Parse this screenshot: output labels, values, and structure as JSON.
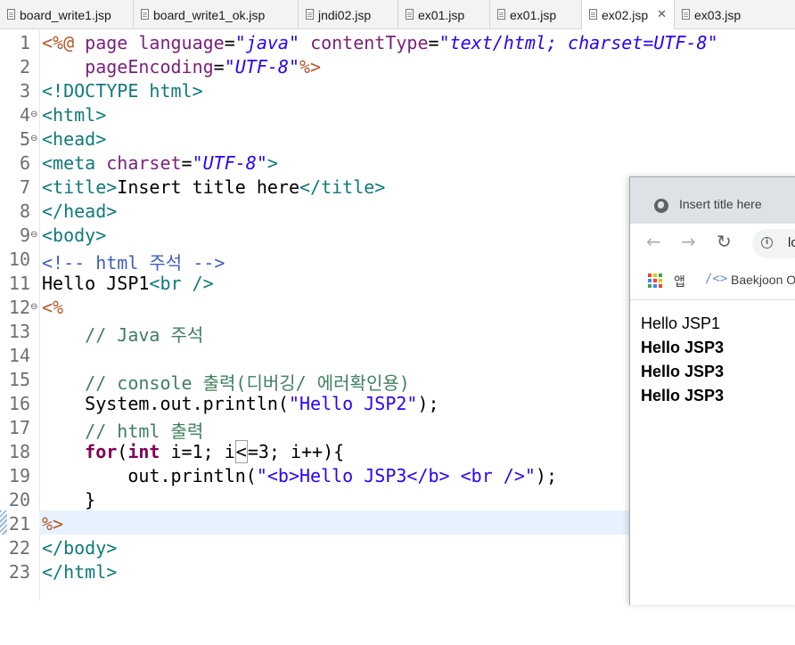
{
  "tabs": [
    {
      "label": "board_write1.jsp"
    },
    {
      "label": "board_write1_ok.jsp"
    },
    {
      "label": "jndi02.jsp"
    },
    {
      "label": "ex01.jsp"
    },
    {
      "label": "ex01.jsp"
    },
    {
      "label": "ex02.jsp",
      "active": true,
      "close": "✕"
    },
    {
      "label": "ex03.jsp"
    }
  ],
  "editor": {
    "current_line": 21,
    "lines": [
      {
        "n": "1",
        "fold": ""
      },
      {
        "n": "2",
        "fold": ""
      },
      {
        "n": "3",
        "fold": ""
      },
      {
        "n": "4",
        "fold": "⊖"
      },
      {
        "n": "5",
        "fold": "⊖"
      },
      {
        "n": "6",
        "fold": ""
      },
      {
        "n": "7",
        "fold": ""
      },
      {
        "n": "8",
        "fold": ""
      },
      {
        "n": "9",
        "fold": "⊖"
      },
      {
        "n": "10",
        "fold": ""
      },
      {
        "n": "11",
        "fold": ""
      },
      {
        "n": "12",
        "fold": "⊖"
      },
      {
        "n": "13",
        "fold": ""
      },
      {
        "n": "14",
        "fold": ""
      },
      {
        "n": "15",
        "fold": ""
      },
      {
        "n": "16",
        "fold": ""
      },
      {
        "n": "17",
        "fold": ""
      },
      {
        "n": "18",
        "fold": ""
      },
      {
        "n": "19",
        "fold": ""
      },
      {
        "n": "20",
        "fold": ""
      },
      {
        "n": "21",
        "fold": ""
      },
      {
        "n": "22",
        "fold": ""
      },
      {
        "n": "23",
        "fold": ""
      }
    ],
    "tokens": {
      "l1": [
        "<%@ ",
        "page ",
        "language",
        "=",
        "\"java\"",
        " ",
        "contentType",
        "=",
        "\"text/html; charset=UTF-8\""
      ],
      "l2": [
        "    ",
        "pageEncoding",
        "=",
        "\"UTF-8\"",
        "%>"
      ],
      "l3": [
        "<!DOCTYPE html>"
      ],
      "l4": [
        "<html>"
      ],
      "l5": [
        "<head>"
      ],
      "l6": [
        "<meta ",
        "charset",
        "=",
        "\"UTF-8\"",
        ">"
      ],
      "l7": [
        "<title>",
        "Insert title here",
        "</title>"
      ],
      "l8": [
        "</head>"
      ],
      "l9": [
        "<body>"
      ],
      "l10": [
        "<!-- html 주석 -->"
      ],
      "l11": [
        "Hello JSP1",
        "<br />"
      ],
      "l12": [
        "<%"
      ],
      "l13": [
        "    ",
        "// Java 주석"
      ],
      "l14": [
        ""
      ],
      "l15": [
        "    ",
        "// console 출력(디버깅/ 에러확인용)"
      ],
      "l16": [
        "    System.out.println(",
        "\"Hello JSP2\"",
        ");"
      ],
      "l17": [
        "    ",
        "// html 출력"
      ],
      "l18": [
        "    ",
        "for",
        "(",
        "int",
        " i=1; i",
        "<",
        "=3; i++){"
      ],
      "l19": [
        "        out.println(",
        "\"<b>Hello JSP3</b> <br />\"",
        ");"
      ],
      "l20": [
        "    }"
      ],
      "l21": [
        "%>"
      ],
      "l22": [
        "</body>"
      ],
      "l23": [
        "</html>"
      ]
    }
  },
  "browser": {
    "tab_title": "Insert title here",
    "nav": {
      "back": "←",
      "forward": "→",
      "reload": "↻"
    },
    "info_glyph": "i",
    "url_partial": "lo",
    "bookmarks": {
      "apps_label": "앱",
      "code_icon": "/<>",
      "baekjoon_label": "Baekjoon O"
    },
    "output": [
      {
        "text": "Hello JSP1",
        "bold": false
      },
      {
        "text": "Hello JSP3",
        "bold": true
      },
      {
        "text": "Hello JSP3",
        "bold": true
      },
      {
        "text": "Hello JSP3",
        "bold": true
      }
    ],
    "apps_colors": [
      "#ea4335",
      "#fbbc04",
      "#34a853",
      "#4285f4",
      "#ea4335",
      "#fbbc04",
      "#34a853",
      "#4285f4",
      "#ea4335"
    ]
  }
}
